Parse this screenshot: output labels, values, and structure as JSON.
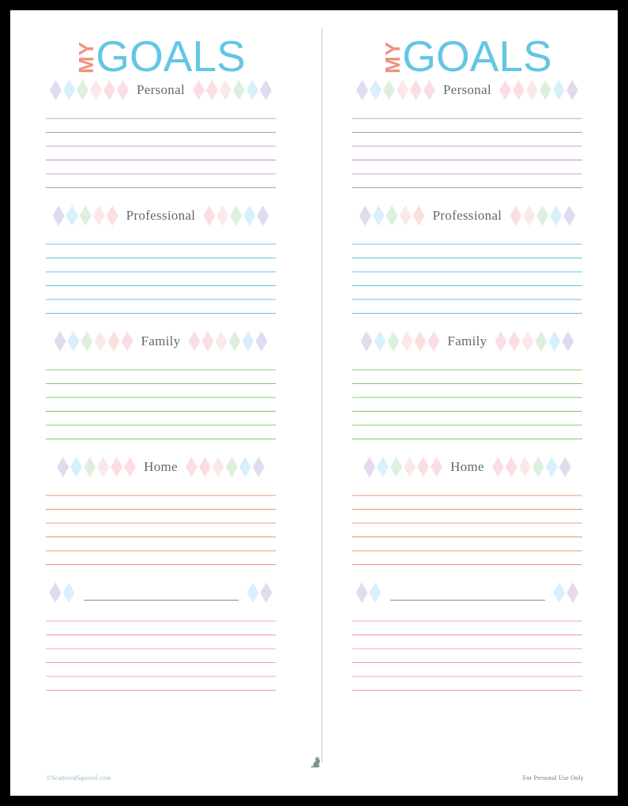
{
  "page": {
    "title_my": "MY",
    "title_goals": "GOALS",
    "title_my_color": "#f0907e",
    "title_goals_color": "#63c6e3",
    "background": "#ffffff",
    "border_color": "#000000",
    "divider_color": "#c9c9c9",
    "squirrel_icon": "squirrel-icon",
    "squirrel_color": "#7b918f"
  },
  "diamond_palette": {
    "lavender": "#e2daee",
    "blue": "#d7f0fb",
    "green": "#ddf0dd",
    "pale_pink": "#fbe8e8",
    "pink": "#fbdfe0",
    "rose": "#fbdde8"
  },
  "sections": [
    {
      "id": "personal",
      "label": "Personal",
      "diamond_count": 6,
      "diamonds_left": [
        "lavender",
        "blue",
        "green",
        "pale_pink",
        "pink",
        "rose"
      ],
      "diamonds_right": [
        "rose",
        "pink",
        "pale_pink",
        "green",
        "blue",
        "lavender"
      ],
      "line_color_light": "#e5cfe8",
      "line_color_dark": "#c08fc9",
      "line_count": 6
    },
    {
      "id": "professional",
      "label": "Professional",
      "diamond_count": 5,
      "diamonds_left": [
        "lavender",
        "blue",
        "green",
        "pale_pink",
        "pink"
      ],
      "diamonds_right": [
        "pink",
        "pale_pink",
        "green",
        "blue",
        "lavender"
      ],
      "line_color_light": "#b3e3f2",
      "line_color_dark": "#5fc3e4",
      "line_count": 6
    },
    {
      "id": "family",
      "label": "Family",
      "diamond_count": 6,
      "diamonds_left": [
        "lavender",
        "blue",
        "green",
        "pale_pink",
        "pink",
        "rose"
      ],
      "diamonds_right": [
        "rose",
        "pink",
        "pale_pink",
        "green",
        "blue",
        "lavender"
      ],
      "line_color_light": "#c5e6b8",
      "line_color_dark": "#84c46b",
      "line_count": 6
    },
    {
      "id": "home",
      "label": "Home",
      "diamond_count": 6,
      "diamonds_left": [
        "lavender",
        "blue",
        "green",
        "pale_pink",
        "pink",
        "rose"
      ],
      "diamonds_right": [
        "rose",
        "pink",
        "pale_pink",
        "green",
        "blue",
        "lavender"
      ],
      "line_color_light": "#f6cbbd",
      "line_color_dark": "#ee8f78",
      "line_count": 6
    },
    {
      "id": "blank",
      "label": "",
      "is_blank": true,
      "diamond_count": 2,
      "diamonds_left": [
        "lavender",
        "blue"
      ],
      "diamonds_right": [
        "blue",
        "lavender"
      ],
      "blank_rule_color": "#8d8d8d",
      "line_color_light": "#fbd2e2",
      "line_color_dark": "#f891b8",
      "line_count": 6
    }
  ],
  "footer": {
    "left": "©ScatteredSquirrel.com",
    "right": "For Personal Use Only"
  }
}
